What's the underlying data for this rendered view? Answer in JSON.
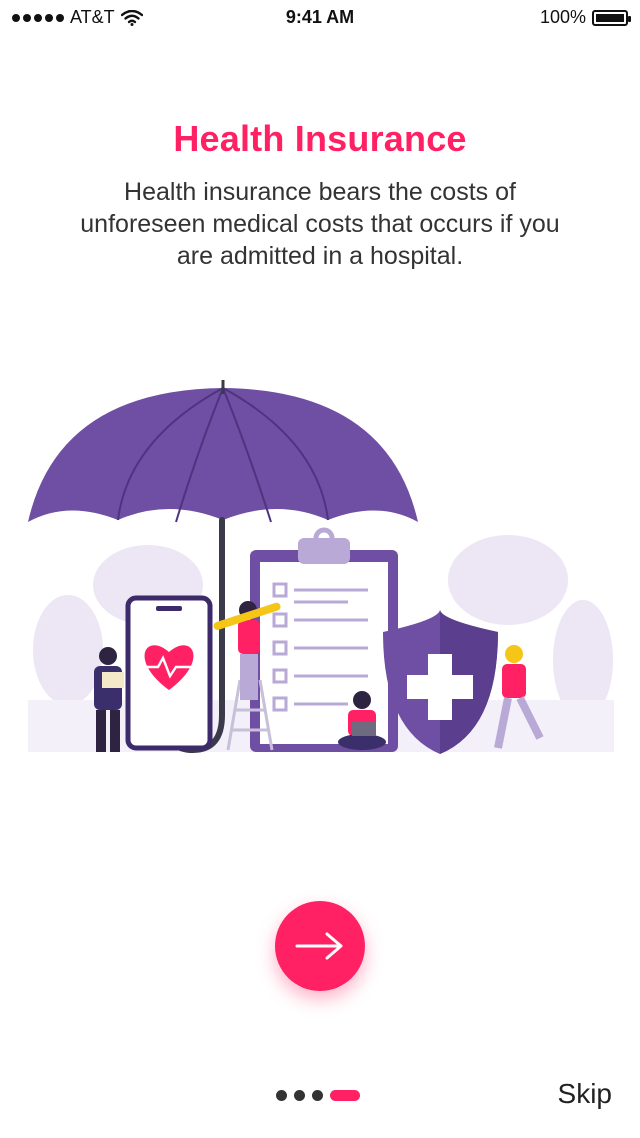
{
  "status_bar": {
    "carrier": "AT&T",
    "time": "9:41 AM",
    "battery_text": "100%"
  },
  "onboarding": {
    "title": "Health Insurance",
    "description": "Health insurance bears the costs of unforeseen medical costs that occurs if you are admitted in a hospital.",
    "skip_label": "Skip",
    "pager": {
      "total": 4,
      "active_index": 3
    }
  },
  "icons": {
    "next": "arrow-right-icon",
    "wifi": "wifi-icon",
    "battery": "battery-icon",
    "signal": "signal-dots-icon"
  },
  "colors": {
    "accent": "#ff2163",
    "illustration_purple": "#6e4fa3",
    "illustration_lavender": "#ece6f5",
    "text": "#333333"
  }
}
